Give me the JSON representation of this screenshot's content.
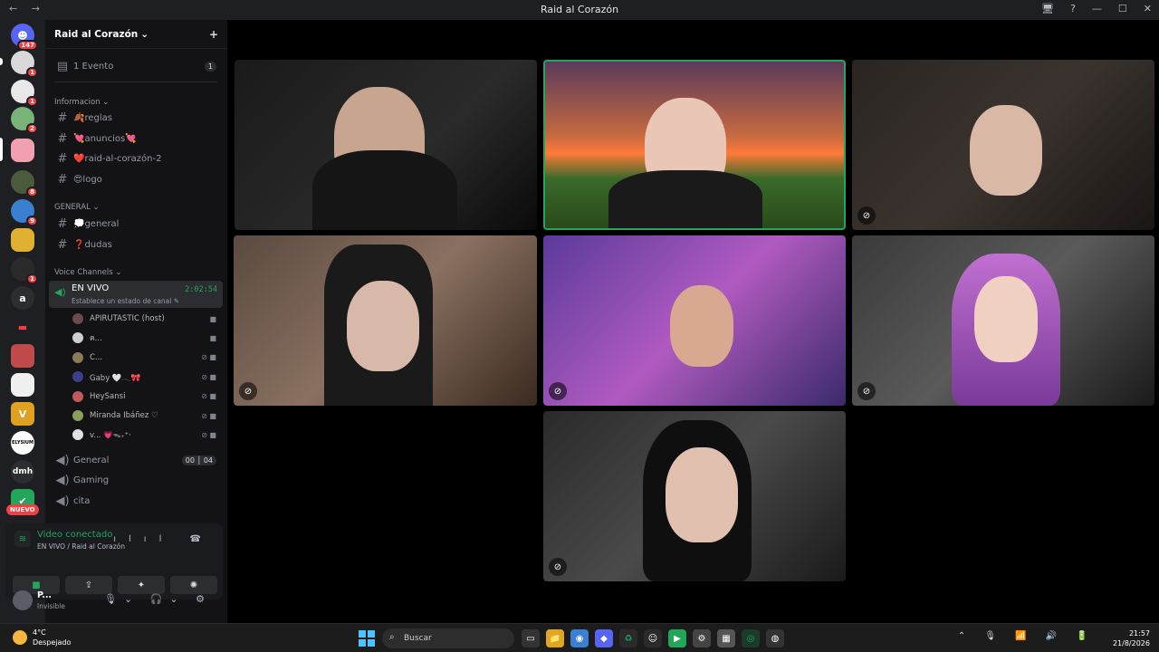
{
  "window": {
    "title": "Raid al Corazón",
    "nav": "← →",
    "controls": [
      "🖥",
      "?",
      "—",
      "☐",
      "✕"
    ]
  },
  "guild_badges": {
    "dm": "147",
    "g1": "1",
    "g2": "1",
    "g3": "2",
    "g5": "8",
    "g6": "9",
    "g8": "1"
  },
  "guild_letters": {
    "a": "a",
    "dmh": "dmh",
    "elysium": "ELYSIUM",
    "v": "V"
  },
  "guild_new": "NUEVO",
  "server": {
    "name": "Raid al Corazón",
    "chevron": "⌄",
    "add_icon": "+"
  },
  "events": {
    "label": "1 Evento",
    "count": "1"
  },
  "categories": {
    "info": "Informacion ⌄",
    "general": "GENERAL ⌄",
    "voice": "Voice Channels ⌄"
  },
  "channels": {
    "reglas": "🍂reglas",
    "anuncios": "💘anuncios💘",
    "raid2": "❤️raid-al-corazón-2",
    "logo": "😍logo",
    "general": "💭general",
    "dudas": "❓dudas"
  },
  "voice_live": {
    "name": "EN VIVO",
    "status": "Establece un estado de canal ✎",
    "timer": "2:02:54"
  },
  "members": [
    {
      "name": "APIRUTASTIC (host)",
      "icons": "■",
      "color": "#6a4a4a"
    },
    {
      "name": "ค...",
      "icons": "■",
      "color": "#cfcfcf"
    },
    {
      "name": "C...",
      "icons": "⊘ ■",
      "color": "#8a7a55"
    },
    {
      "name": "Gaby 🤍𓂃🎀",
      "icons": "⊘ ■",
      "color": "#3d3f8a"
    },
    {
      "name": "HeySansi",
      "icons": "⊘ ■",
      "color": "#c25a5a"
    },
    {
      "name": "Miranda Ibáñez ♡",
      "icons": "⊘ ■",
      "color": "#8aa05a"
    },
    {
      "name": "v... 💗ᯓ₊⁺‧",
      "icons": "⊘ ■",
      "color": "#e0e0e0"
    }
  ],
  "voice_channels": {
    "general": "General",
    "general_counts": "00 │ 04",
    "gaming": "Gaming",
    "cita": "cita"
  },
  "connection": {
    "status": "Video conectado",
    "location": "EN VIVO / Raid al Corazón",
    "controls": "ılıl ☎"
  },
  "actions": [
    "■",
    "⇪",
    "✦",
    "✺"
  ],
  "user": {
    "name": "P...",
    "status": "Invisible",
    "controls": "🎙⌄ 🎧⌄ ⚙"
  },
  "taskbar": {
    "temp": "4°C",
    "weather": "Despejado",
    "search": "Buscar",
    "search_icon": "⌕",
    "apps": [
      "▭",
      "📁",
      "◉",
      "◆",
      "♻",
      "☺",
      "▶",
      "⚙",
      "▦",
      "◎",
      "◍"
    ],
    "tray": "⌃ 🎙 📶 🔊 🔋",
    "time": "21:57",
    "date": "21/8/2026"
  }
}
